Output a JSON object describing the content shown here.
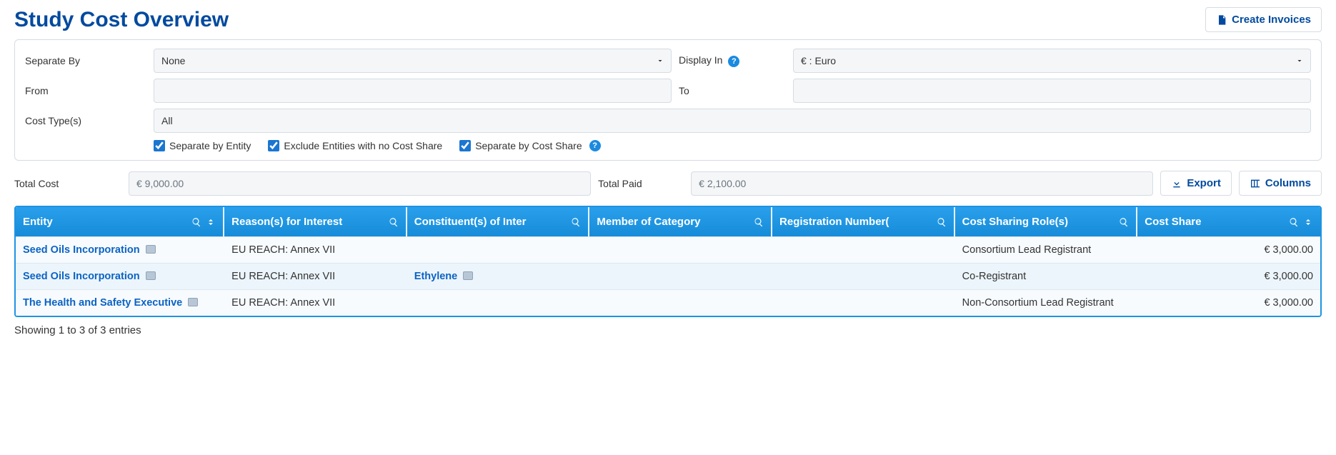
{
  "header": {
    "title": "Study Cost Overview",
    "create_invoices_label": "Create Invoices"
  },
  "filters": {
    "separate_by_label": "Separate By",
    "separate_by_value": "None",
    "display_in_label": "Display In",
    "display_in_value": "€ : Euro",
    "from_label": "From",
    "from_value": "",
    "to_label": "To",
    "to_value": "",
    "cost_types_label": "Cost Type(s)",
    "cost_types_value": "All",
    "separate_by_entity_label": "Separate by Entity",
    "exclude_no_share_label": "Exclude Entities with no Cost Share",
    "separate_by_cost_share_label": "Separate by Cost Share"
  },
  "totals": {
    "total_cost_label": "Total Cost",
    "total_cost_value": "€ 9,000.00",
    "total_paid_label": "Total Paid",
    "total_paid_value": "€ 2,100.00",
    "export_label": "Export",
    "columns_label": "Columns"
  },
  "table": {
    "columns": {
      "entity": "Entity",
      "reasons": "Reason(s) for Interest",
      "constituents": "Constituent(s) of Inter",
      "member_of": "Member of Category",
      "reg_number": "Registration Number(",
      "roles": "Cost Sharing Role(s)",
      "cost_share": "Cost Share"
    },
    "rows": [
      {
        "entity": "Seed Oils Incorporation",
        "reasons": "EU REACH: Annex VII",
        "constituents": "",
        "member_of": "",
        "reg_number": "",
        "roles": "Consortium Lead Registrant",
        "cost_share": "€ 3,000.00"
      },
      {
        "entity": "Seed Oils Incorporation",
        "reasons": "EU REACH: Annex VII",
        "constituents": "Ethylene",
        "member_of": "",
        "reg_number": "",
        "roles": "Co-Registrant",
        "cost_share": "€ 3,000.00"
      },
      {
        "entity": "The Health and Safety Executive",
        "reasons": "EU REACH: Annex VII",
        "constituents": "",
        "member_of": "",
        "reg_number": "",
        "roles": "Non-Consortium Lead Registrant",
        "cost_share": "€ 3,000.00"
      }
    ]
  },
  "footer": "Showing 1 to 3 of 3 entries"
}
